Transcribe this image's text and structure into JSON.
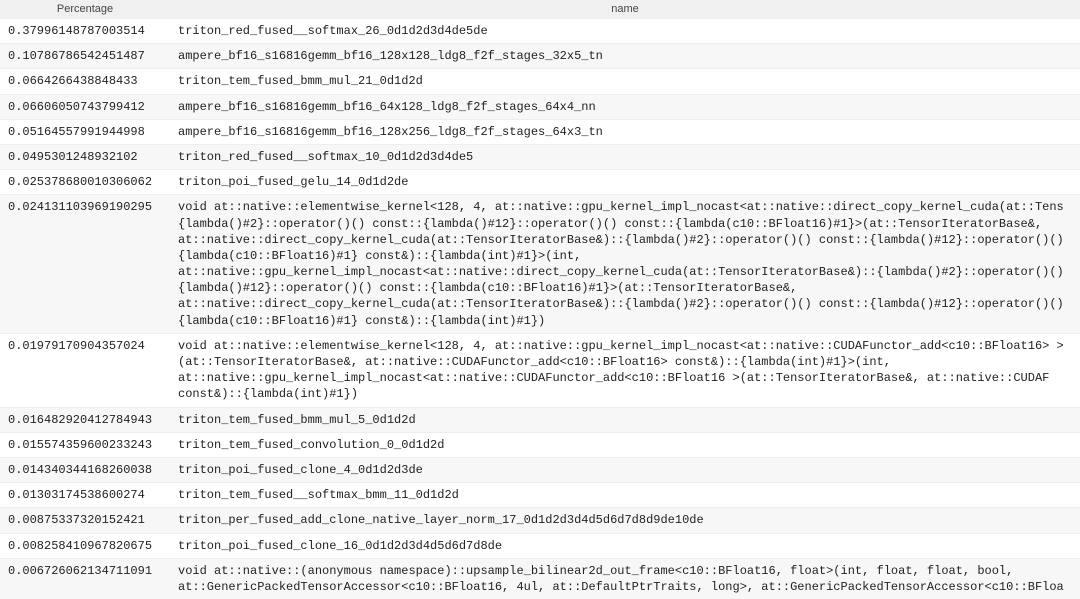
{
  "table": {
    "headers": {
      "percentage": "Percentage",
      "name": "name"
    },
    "rows": [
      {
        "percentage": "0.37996148787003514",
        "name": "triton_red_fused__softmax_26_0d1d2d3d4de5de"
      },
      {
        "percentage": "0.10786786542451487",
        "name": "ampere_bf16_s16816gemm_bf16_128x128_ldg8_f2f_stages_32x5_tn"
      },
      {
        "percentage": "0.0664266438848433",
        "name": "triton_tem_fused_bmm_mul_21_0d1d2d"
      },
      {
        "percentage": "0.06606050743799412",
        "name": "ampere_bf16_s16816gemm_bf16_64x128_ldg8_f2f_stages_64x4_nn"
      },
      {
        "percentage": "0.05164557991944998",
        "name": "ampere_bf16_s16816gemm_bf16_128x256_ldg8_f2f_stages_64x3_tn"
      },
      {
        "percentage": "0.0495301248932102",
        "name": "triton_red_fused__softmax_10_0d1d2d3d4de5"
      },
      {
        "percentage": "0.025378680010306062",
        "name": "triton_poi_fused_gelu_14_0d1d2de"
      },
      {
        "percentage": "0.024131103969190295",
        "name": "void at::native::elementwise_kernel<128, 4, at::native::gpu_kernel_impl_nocast<at::native::direct_copy_kernel_cuda(at::Tens {lambda()#2}::operator()() const::{lambda()#12}::operator()() const::{lambda(c10::BFloat16)#1}>(at::TensorIteratorBase&, at::native::direct_copy_kernel_cuda(at::TensorIteratorBase&)::{lambda()#2}::operator()() const::{lambda()#12}::operator()() {lambda(c10::BFloat16)#1} const&)::{lambda(int)#1}>(int, at::native::gpu_kernel_impl_nocast<at::native::direct_copy_kernel_cuda(at::TensorIteratorBase&)::{lambda()#2}::operator()() {lambda()#12}::operator()() const::{lambda(c10::BFloat16)#1}>(at::TensorIteratorBase&, at::native::direct_copy_kernel_cuda(at::TensorIteratorBase&)::{lambda()#2}::operator()() const::{lambda()#12}::operator()() {lambda(c10::BFloat16)#1} const&)::{lambda(int)#1})"
      },
      {
        "percentage": "0.01979170904357024",
        "name": "void at::native::elementwise_kernel<128, 4, at::native::gpu_kernel_impl_nocast<at::native::CUDAFunctor_add<c10::BFloat16> > (at::TensorIteratorBase&, at::native::CUDAFunctor_add<c10::BFloat16> const&)::{lambda(int)#1}>(int, at::native::gpu_kernel_impl_nocast<at::native::CUDAFunctor_add<c10::BFloat16 >(at::TensorIteratorBase&, at::native::CUDAF const&)::{lambda(int)#1})"
      },
      {
        "percentage": "0.016482920412784943",
        "name": "triton_tem_fused_bmm_mul_5_0d1d2d"
      },
      {
        "percentage": "0.015574359600233243",
        "name": "triton_tem_fused_convolution_0_0d1d2d"
      },
      {
        "percentage": "0.014340344168260038",
        "name": "triton_poi_fused_clone_4_0d1d2d3de"
      },
      {
        "percentage": "0.01303174538600274",
        "name": "triton_tem_fused__softmax_bmm_11_0d1d2d"
      },
      {
        "percentage": "0.00875337320152421",
        "name": "triton_per_fused_add_clone_native_layer_norm_17_0d1d2d3d4d5d6d7d8d9de10de"
      },
      {
        "percentage": "0.008258410967820675",
        "name": "triton_poi_fused_clone_16_0d1d2d3d4d5d6d7d8de"
      },
      {
        "percentage": "0.006726062134711091",
        "name": "void at::native::(anonymous namespace)::upsample_bilinear2d_out_frame<c10::BFloat16, float>(int, float, float, bool, at::GenericPackedTensorAccessor<c10::BFloat16, 4ul, at::DefaultPtrTraits, long>, at::GenericPackedTensorAccessor<c10::BFloa"
      }
    ]
  }
}
